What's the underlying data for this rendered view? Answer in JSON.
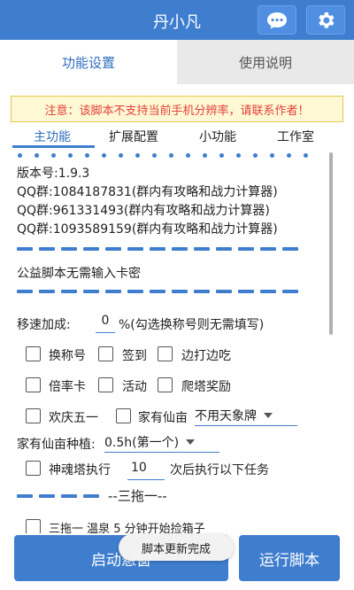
{
  "header": {
    "title": "丹小凡",
    "chat_icon": "chat-bubble-icon",
    "settings_icon": "gear-icon",
    "color": "#3f7ecf"
  },
  "top_tabs": [
    {
      "label": "功能设置",
      "active": true
    },
    {
      "label": "使用说明",
      "active": false
    }
  ],
  "warning": "注意：该脚本不支持当前手机分辨率，请联系作者！",
  "sub_tabs": [
    {
      "label": "主功能",
      "active": true
    },
    {
      "label": "扩展配置"
    },
    {
      "label": "小功能"
    },
    {
      "label": "工作室"
    }
  ],
  "info": {
    "version": "版本号:1.9.3",
    "qq1": "QQ群:1084187831(群内有攻略和战力计算器)",
    "qq2": "QQ群:961331493(群内有攻略和战力计算器)",
    "qq3": "QQ群:1093589159(群内有攻略和战力计算器)",
    "free_note": "公益脚本无需输入卡密"
  },
  "speed": {
    "label": "移速加成:",
    "value": "0",
    "hint": "%(勾选换称号则无需填写)"
  },
  "checkboxes_row1": [
    {
      "label": "换称号",
      "checked": false
    },
    {
      "label": "签到",
      "checked": false
    },
    {
      "label": "边打边吃",
      "checked": false
    }
  ],
  "checkboxes_row2": [
    {
      "label": "倍率卡",
      "checked": false
    },
    {
      "label": "活动",
      "checked": false
    },
    {
      "label": "爬塔奖励",
      "checked": false
    }
  ],
  "checkboxes_row3": [
    {
      "label": "欢庆五一",
      "checked": false
    },
    {
      "label": "家有仙亩",
      "checked": false
    }
  ],
  "xianmu_select": "不用天象牌",
  "planting": {
    "label": "家有仙亩种植:",
    "value": "0.5h(第一个)"
  },
  "soul_tower": {
    "label": "神魂塔执行",
    "value": "10",
    "suffix": "次后执行以下任务",
    "checked": false
  },
  "section": "--三拖一--",
  "partial_row": "三拖一 温泉 5 分钟开始捡箱子",
  "buttons": {
    "start": "启动悬窗",
    "run": "运行脚本"
  },
  "toast": "脚本更新完成"
}
